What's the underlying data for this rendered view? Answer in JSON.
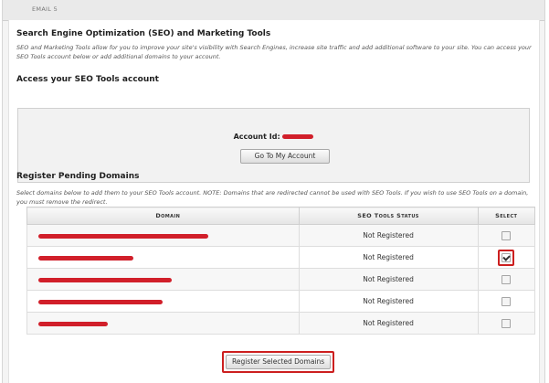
{
  "topbar": {
    "label": "EMAIL 5"
  },
  "seo": {
    "title": "Search Engine Optimization (SEO) and Marketing Tools",
    "description": "SEO and Marketing Tools allow for you to improve your site's visibility with Search Engines, increase site traffic and add additional software to your site. You can access your SEO Tools account below or add additional domains to your account."
  },
  "access": {
    "title": "Access your SEO Tools account",
    "account_label": "Account Id:",
    "go_button": "Go To My Account"
  },
  "pending": {
    "title": "Register Pending Domains",
    "description": "Select domains below to add them to your SEO Tools account. NOTE: Domains that are redirected cannot be used with SEO Tools. If you wish to use SEO Tools on a domain, you must remove the redirect.",
    "columns": {
      "domain": "Domain",
      "status": "SEO Tools Status",
      "select": "Select"
    },
    "rows": [
      {
        "status": "Not Registered",
        "selected": false
      },
      {
        "status": "Not Registered",
        "selected": true
      },
      {
        "status": "Not Registered",
        "selected": false
      },
      {
        "status": "Not Registered",
        "selected": false
      },
      {
        "status": "Not Registered",
        "selected": false
      }
    ],
    "register_button": "Register Selected Domains"
  },
  "colors": {
    "redaction": "#d11f2a",
    "highlight": "#cc1f1f"
  }
}
